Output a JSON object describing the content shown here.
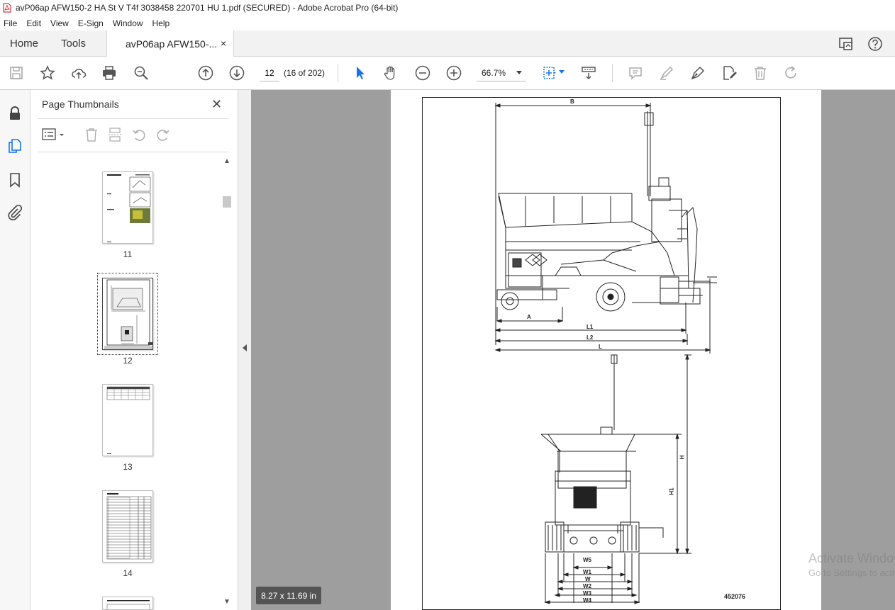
{
  "window": {
    "title": "avP06ap AFW150-2 HA St V T4f 3038458 220701 HU 1.pdf (SECURED) - Adobe Acrobat Pro (64-bit)"
  },
  "menu": [
    "File",
    "Edit",
    "View",
    "E-Sign",
    "Window",
    "Help"
  ],
  "tabs": {
    "home": "Home",
    "tools": "Tools",
    "document": "avP06ap AFW150-...",
    "close": "×"
  },
  "toolbar": {
    "page_current": "12",
    "page_count": "(16 of 202)",
    "zoom": "66.7%"
  },
  "panel": {
    "title": "Page Thumbnails",
    "close": "✕",
    "thumbnails": [
      {
        "label": "11"
      },
      {
        "label": "12"
      },
      {
        "label": "13"
      },
      {
        "label": "14"
      }
    ]
  },
  "document_page": {
    "dimension_labels": {
      "B": "B",
      "A": "A",
      "L1": "L1",
      "L2": "L2",
      "L": "L",
      "H": "H",
      "H1": "H1",
      "W5": "W5",
      "W1": "W1",
      "W": "W",
      "W2": "W2",
      "W3": "W3",
      "W4": "W4"
    },
    "drawing_code": "452076"
  },
  "status": {
    "page_size": "8.27 x 11.69 in"
  },
  "watermark": {
    "line1": "Activate Windows",
    "line2": "Go to Settings to activate Windows."
  },
  "colors": {
    "accent_blue": "#1473e6",
    "pdf_red": "#d7373f",
    "viewer_bg": "#9e9e9e"
  }
}
